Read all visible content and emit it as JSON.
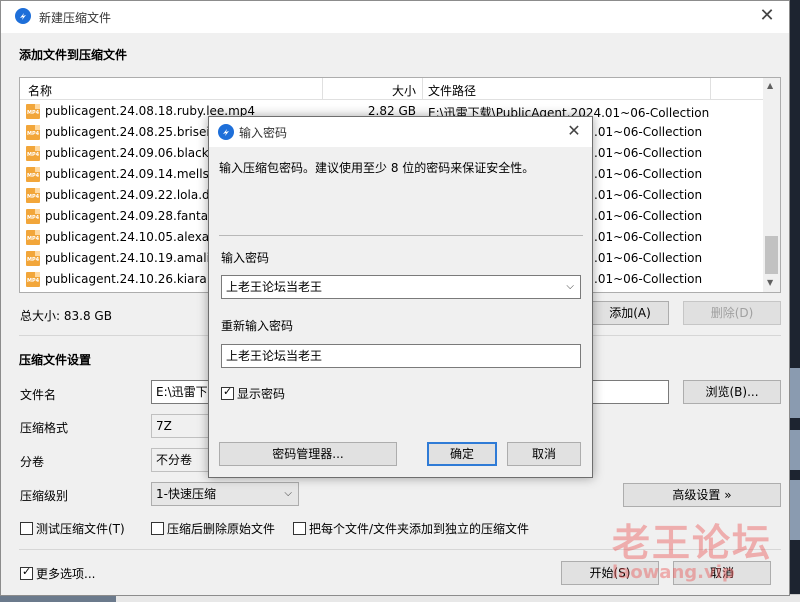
{
  "main": {
    "title": "新建压缩文件",
    "add_section": "添加文件到压缩文件",
    "columns": {
      "name": "名称",
      "size": "大小",
      "path": "文件路径"
    },
    "files": [
      {
        "name": "publicagent.24.08.18.ruby.lee.mp4",
        "size": "2.82 GB",
        "path": "E:\\迅雷下载\\PublicAgent.2024.01~06-Collection"
      },
      {
        "name": "publicagent.24.08.25.briseida",
        "size": "",
        "path": ".01~06-Collection"
      },
      {
        "name": "publicagent.24.09.06.black.an",
        "size": "",
        "path": ".01~06-Collection"
      },
      {
        "name": "publicagent.24.09.14.mells.bl",
        "size": "",
        "path": ".01~06-Collection"
      },
      {
        "name": "publicagent.24.09.22.lola.dar",
        "size": "",
        "path": ".01~06-Collection"
      },
      {
        "name": "publicagent.24.09.28.fanta.sie",
        "size": "",
        "path": ".01~06-Collection"
      },
      {
        "name": "publicagent.24.10.05.alexa.th",
        "size": "",
        "path": ".01~06-Collection"
      },
      {
        "name": "publicagent.24.10.19.amalia.c",
        "size": "",
        "path": ".01~06-Collection"
      },
      {
        "name": "publicagent.24.10.26.kiara.lo",
        "size": "",
        "path": ".01~06-Collection"
      }
    ],
    "total_size": "总大小: 83.8 GB",
    "add_button": "添加(A)",
    "delete_button": "删除(D)",
    "settings_section": "压缩文件设置",
    "filename_label": "文件名",
    "filename_value": "E:\\迅雷下载",
    "browse_button": "浏览(B)...",
    "format_label": "压缩格式",
    "format_value": "7Z",
    "split_label": "分卷",
    "split_value": "不分卷",
    "level_label": "压缩级别",
    "level_value": "1-快速压缩",
    "advanced_button": "高级设置 »",
    "test_label": "测试压缩文件(T)",
    "delete_after_label": "压缩后删除原始文件",
    "separate_label": "把每个文件/文件夹添加到独立的压缩文件",
    "more_options_label": "更多选项...",
    "start_button": "开始(S)",
    "cancel_button": "取消"
  },
  "dialog": {
    "title": "输入密码",
    "description": "输入压缩包密码。建议使用至少 8 位的密码来保证安全性。",
    "password_label": "输入密码",
    "password_value": "上老王论坛当老王",
    "confirm_label": "重新输入密码",
    "confirm_value": "上老王论坛当老王",
    "show_password_label": "显示密码",
    "manager_button": "密码管理器...",
    "ok_button": "确定",
    "cancel_button": "取消"
  },
  "watermark": {
    "text": "老王论坛",
    "url": "laowang.vip"
  },
  "states": {
    "show_password": true,
    "more_options": true,
    "test": false,
    "delete_after": false,
    "separate": false
  },
  "colors": {
    "accent": "#1e6fd9",
    "file_icon": "#f2a63a",
    "watermark": "#eb5a5a"
  }
}
